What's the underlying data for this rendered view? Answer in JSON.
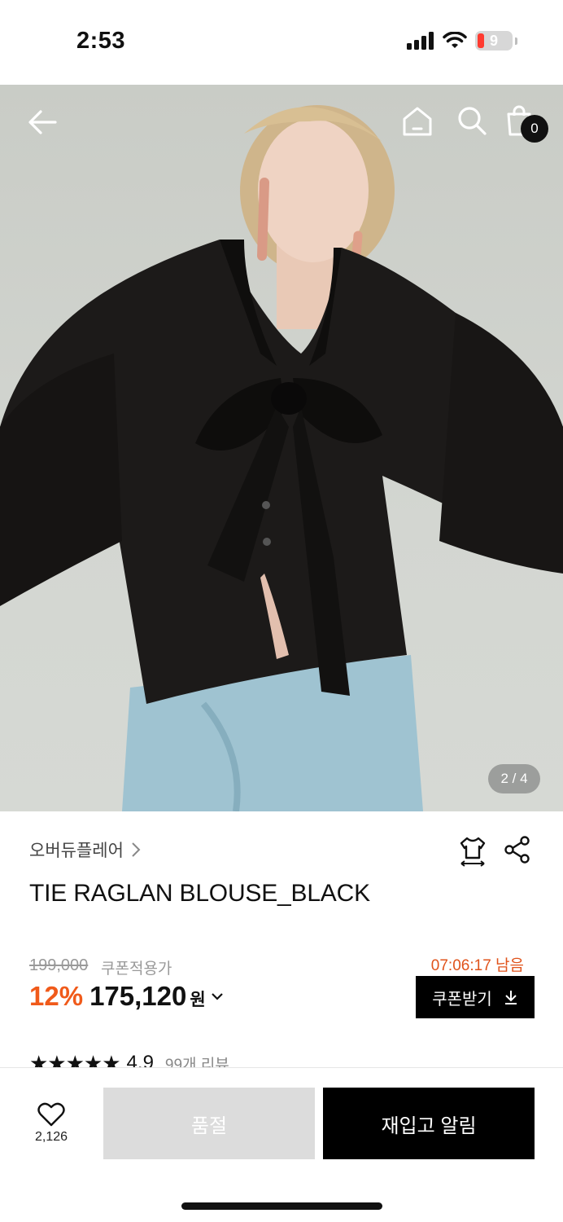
{
  "status_bar": {
    "time": "2:53",
    "battery": "9"
  },
  "header": {
    "back_icon": "arrow-left-icon",
    "home_icon": "home-icon",
    "search_icon": "search-icon",
    "cart_icon": "shopping-bag-icon",
    "cart_count": "0"
  },
  "gallery": {
    "indicator": "2 / 4"
  },
  "product": {
    "brand": "오버듀플레어",
    "title": "TIE RAGLAN BLOUSE_BLACK",
    "original_price": "199,000",
    "coupon_label": "쿠폰적용가",
    "discount": "12%",
    "price": "175,120",
    "currency": "원",
    "countdown": "07:06:17 남음",
    "coupon_button": "쿠폰받기",
    "stars": "★★★★★",
    "rating": "4.9",
    "reviews": "99개 리뷰"
  },
  "bottom_bar": {
    "like_count": "2,126",
    "soldout_label": "품절",
    "restock_label": "재입고 알림"
  },
  "colors": {
    "accent": "#f05a1a",
    "black": "#000000",
    "disabled": "#dcdcdc"
  }
}
